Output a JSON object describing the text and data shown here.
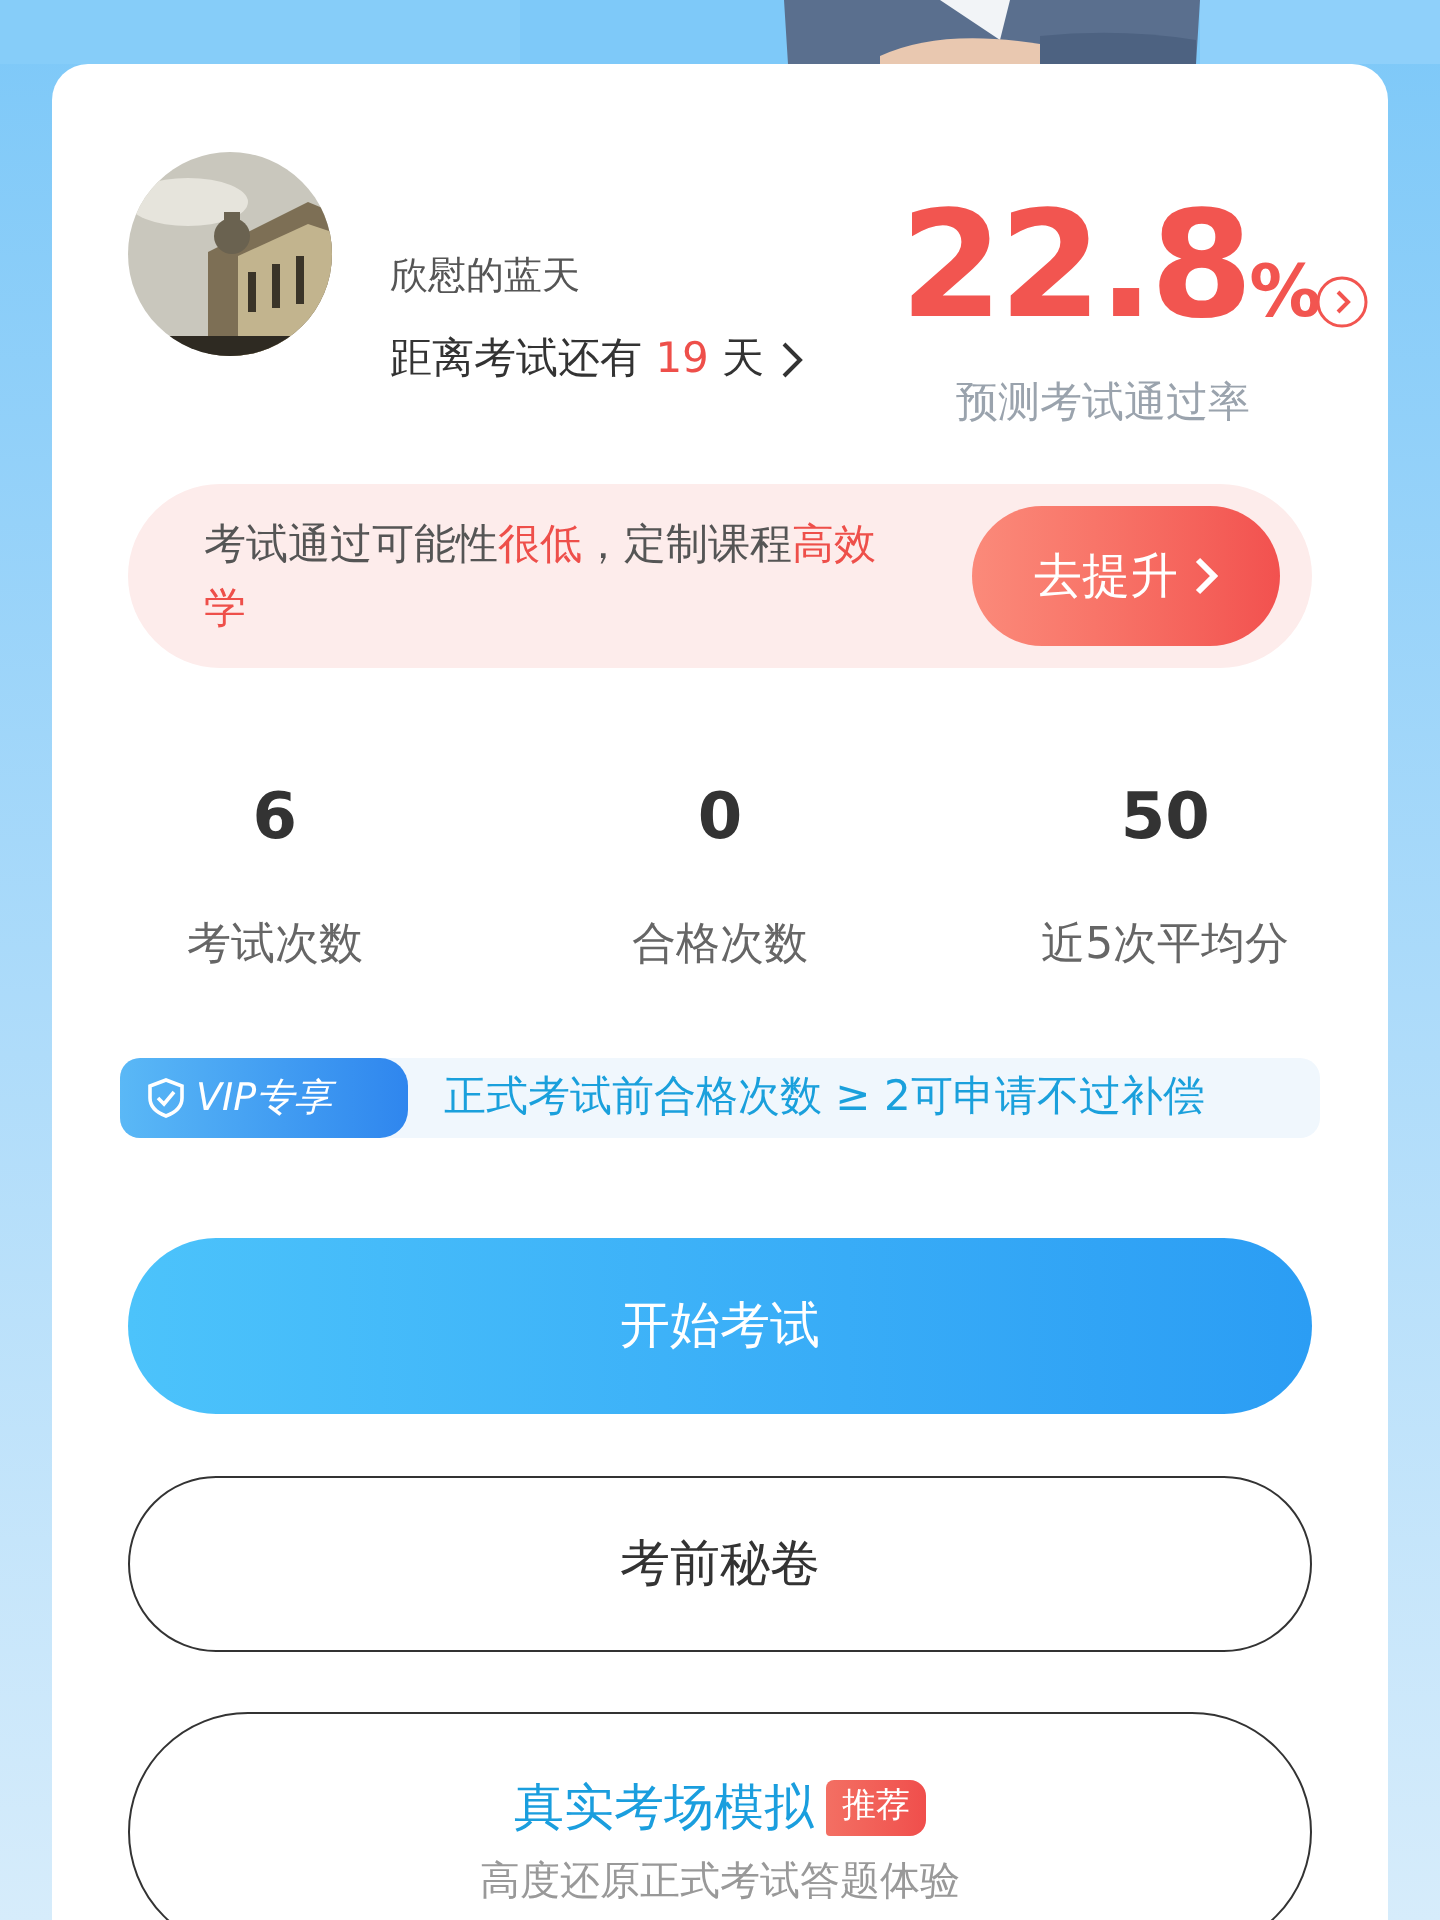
{
  "profile": {
    "name": "欣慰的蓝天",
    "countdown": [
      {
        "text": "距离考试还有 ",
        "highlight": false
      },
      {
        "text": "19",
        "highlight": true
      },
      {
        "text": " 天",
        "highlight": false
      }
    ]
  },
  "pass_rate": {
    "value": "22.8",
    "unit": "%",
    "label": "预测考试通过率"
  },
  "advice": {
    "segments": [
      {
        "text": "考试通过可能性",
        "highlight": false
      },
      {
        "text": "很低",
        "highlight": true
      },
      {
        "text": "，定制课程",
        "highlight": false
      },
      {
        "text": "高效学",
        "highlight": true
      }
    ],
    "button": "去提升"
  },
  "stats": [
    {
      "value": "6",
      "label": "考试次数"
    },
    {
      "value": "0",
      "label": "合格次数"
    },
    {
      "value": "50",
      "label": "近5次平均分"
    }
  ],
  "vip": {
    "badge": "VIP专享",
    "text": "正式考试前合格次数 ≥ 2可申请不过补偿"
  },
  "actions": [
    {
      "kind": "primary",
      "label": "开始考试"
    },
    {
      "kind": "outline",
      "label": "考前秘卷"
    },
    {
      "kind": "featured",
      "label": "真实考场模拟",
      "tag": "推荐",
      "subtitle": "高度还原正式考试答题体验"
    }
  ]
}
